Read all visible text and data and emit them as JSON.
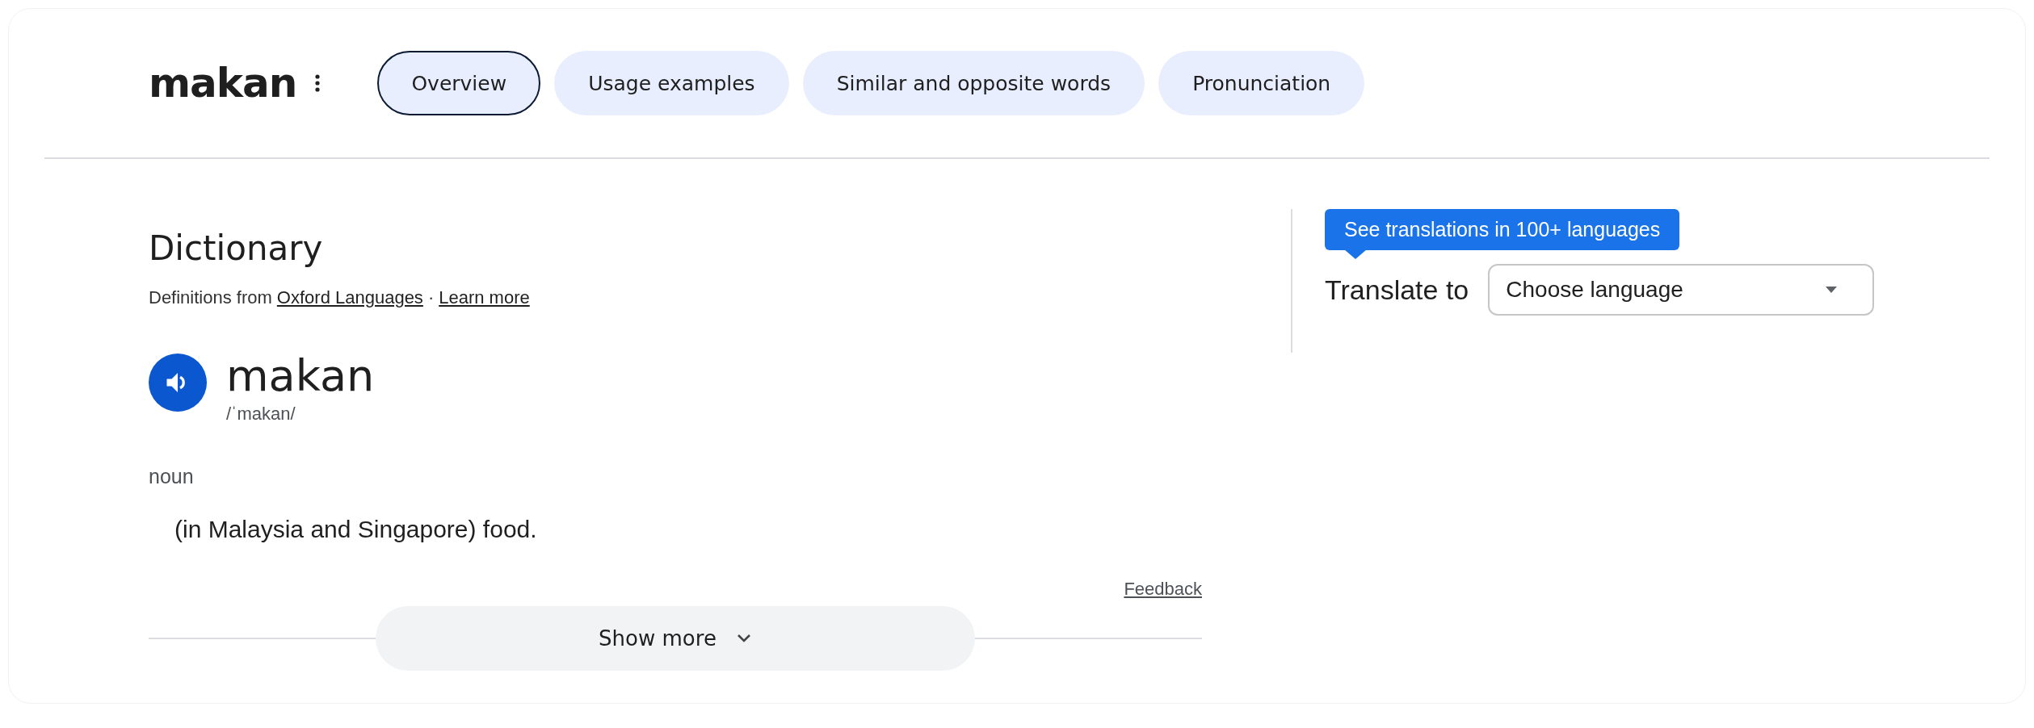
{
  "header": {
    "title": "makan"
  },
  "tabs": [
    {
      "label": "Overview",
      "selected": true
    },
    {
      "label": "Usage examples",
      "selected": false
    },
    {
      "label": "Similar and opposite words",
      "selected": false
    },
    {
      "label": "Pronunciation",
      "selected": false
    }
  ],
  "dictionary": {
    "heading": "Dictionary",
    "source_prefix": "Definitions from",
    "source_link": "Oxford Languages",
    "separator": "·",
    "learn_more": "Learn more",
    "headword": "makan",
    "phonetic": "/ˈmakan/",
    "part_of_speech": "noun",
    "definition": "(in Malaysia and Singapore) food.",
    "feedback": "Feedback",
    "show_more": "Show more"
  },
  "translate": {
    "tooltip": "See translations in 100+ languages",
    "label": "Translate to",
    "placeholder": "Choose language"
  }
}
